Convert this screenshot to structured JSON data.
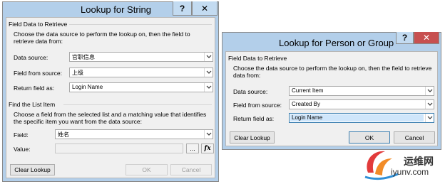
{
  "string_dialog": {
    "title": "Lookup for String",
    "help_label": "?",
    "close_label": "✕",
    "field_section_title": "Field Data to Retrieve",
    "field_section_desc": "Choose the data source to perform the lookup on, then the field to retrieve data from:",
    "data_source_label": "Data source:",
    "data_source_value": "官职信息",
    "field_from_source_label": "Field from source:",
    "field_from_source_value": "上级",
    "return_field_label": "Return field as:",
    "return_field_value": "Login Name",
    "find_section_title": "Find the List Item",
    "find_section_desc": "Choose a field from the selected list and a matching value that identifies the specific item you want from the data source:",
    "field_label": "Field:",
    "field_value": "姓名",
    "value_label": "Value:",
    "value_value": "",
    "ellipsis_label": "...",
    "fx_label": "fx",
    "clear_lookup_label": "Clear Lookup",
    "ok_label": "OK",
    "cancel_label": "Cancel"
  },
  "person_dialog": {
    "title": "Lookup for Person or Group",
    "help_label": "?",
    "close_label": "✕",
    "field_section_title": "Field Data to Retrieve",
    "field_section_desc": "Choose the data source to perform the lookup on, then the field to retrieve data from:",
    "data_source_label": "Data source:",
    "data_source_value": "Current Item",
    "field_from_source_label": "Field from source:",
    "field_from_source_value": "Created By",
    "return_field_label": "Return field as:",
    "return_field_value": "Login Name",
    "clear_lookup_label": "Clear Lookup",
    "ok_label": "OK",
    "cancel_label": "Cancel"
  },
  "watermark": {
    "text_cn": "运维网",
    "text_url": "iyunv.com"
  },
  "colors": {
    "dialog_frame": "#b5d0ea",
    "client_bg": "#f0f0f0",
    "close_button": "#c75050",
    "selection": "#cfe6fb"
  }
}
